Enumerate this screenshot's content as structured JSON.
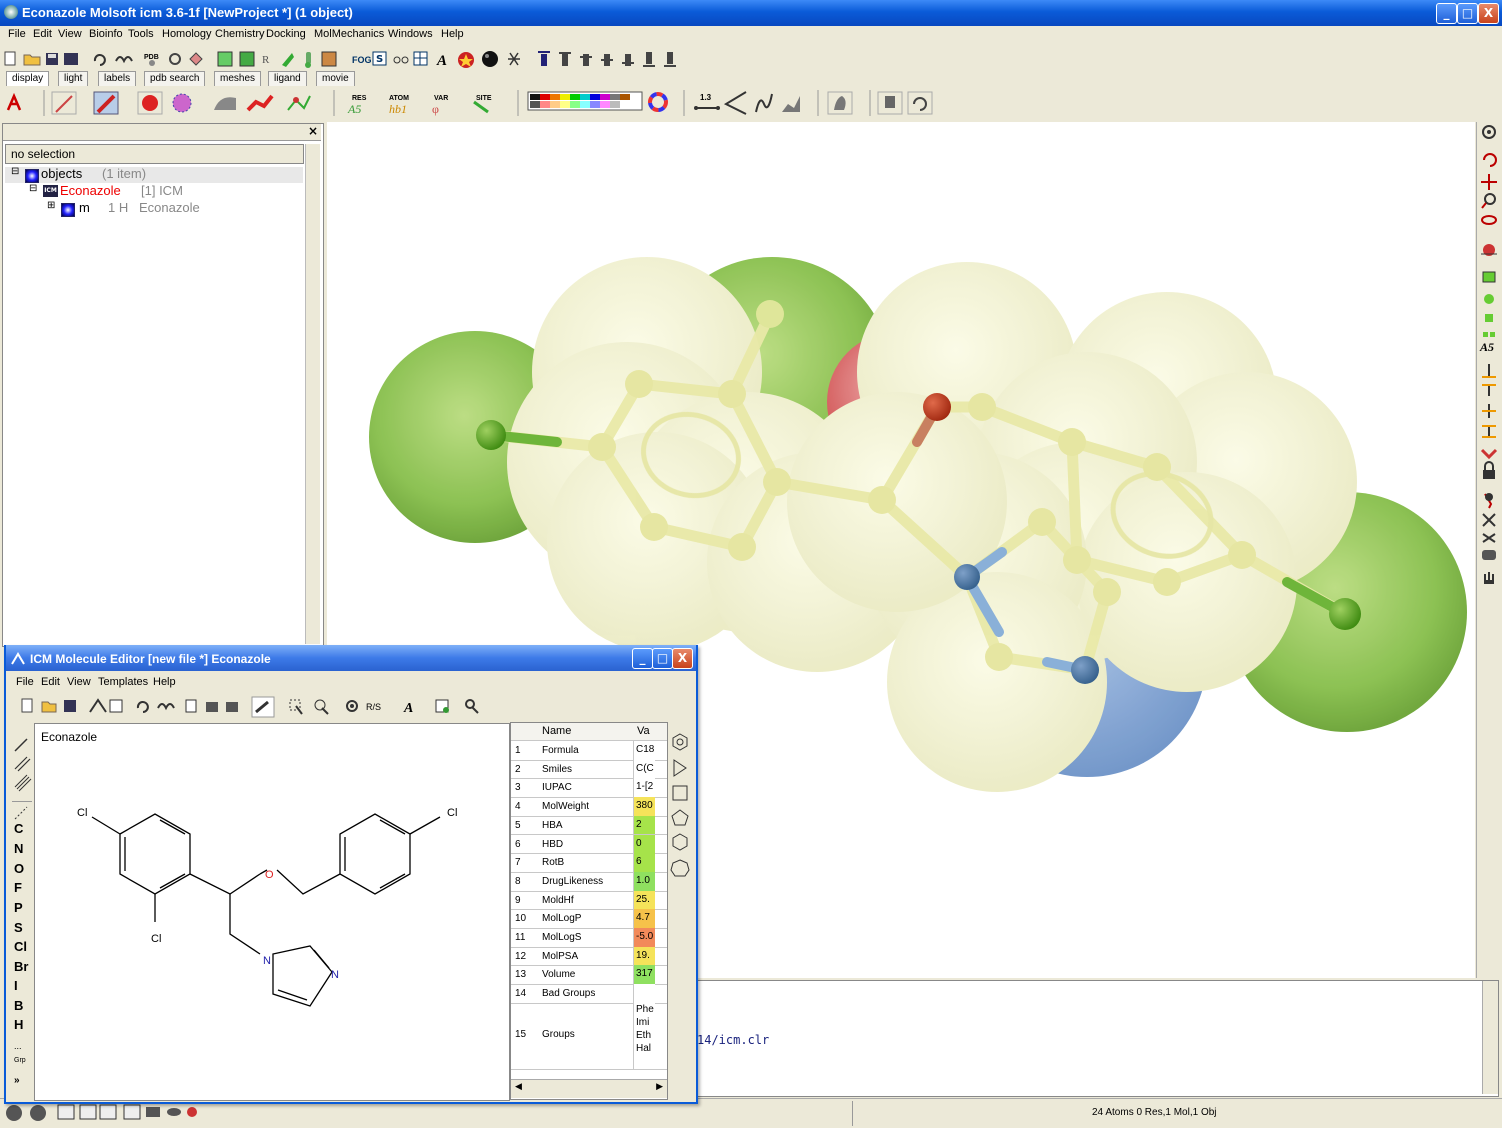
{
  "app": {
    "title": "Econazole Molsoft icm 3.6-1f  [NewProject *] (1 object)",
    "menu": [
      "File",
      "Edit",
      "View",
      "Bioinfo",
      "Tools",
      "Homology",
      "Chemistry",
      "Docking",
      "MolMechanics",
      "Windows",
      "Help"
    ],
    "window_buttons": {
      "minimize": "_",
      "maximize": "□",
      "close": "X"
    }
  },
  "toolbar_tabs": [
    "display",
    "light",
    "labels",
    "pdb search",
    "meshes",
    "ligand",
    "movie"
  ],
  "toolbar_text": {
    "pdb": "PDB",
    "fog": "FOG",
    "res": "RES",
    "res_sub": "A5",
    "atom": "ATOM",
    "atom_sub": "hb1",
    "var": "VAR",
    "site": "SITE",
    "dist": "1.3"
  },
  "workspace": {
    "selection": "no selection",
    "tree": {
      "root_label": "objects",
      "root_count": "(1 item)",
      "object_name": "Econazole",
      "object_info": "[1] ICM",
      "object_badge": "ICM",
      "mol_name": "m",
      "mol_count": "1 H",
      "mol_label": "Econazole"
    },
    "close_glyph": "×"
  },
  "console": {
    "line": "14/icm.clr"
  },
  "status": {
    "text": "24 Atoms 0 Res,1 Mol,1 Obj"
  },
  "editor": {
    "title": "ICM Molecule Editor [new file *] Econazole",
    "menu": [
      "File",
      "Edit",
      "View",
      "Templates",
      "Help"
    ],
    "molecule_name": "Econazole",
    "rs_label": "R/S",
    "atoms": [
      "C",
      "N",
      "O",
      "F",
      "P",
      "S",
      "Cl",
      "Br",
      "I",
      "B",
      "H"
    ],
    "atom_more": "...",
    "grp_label": "Grp",
    "structure_labels": {
      "cl1": "Cl",
      "cl2": "Cl",
      "cl3": "Cl",
      "o": "O",
      "n1": "N",
      "n2": "N"
    },
    "table_headers": {
      "name": "Name",
      "value": "Va"
    },
    "properties": [
      {
        "n": "1",
        "name": "Formula",
        "value": "C18",
        "color": "#ffffff"
      },
      {
        "n": "2",
        "name": "Smiles",
        "value": "C(C",
        "color": "#ffffff"
      },
      {
        "n": "3",
        "name": "IUPAC",
        "value": "1-[2",
        "color": "#ffffff"
      },
      {
        "n": "4",
        "name": "MolWeight",
        "value": "380",
        "color": "#f5e35a"
      },
      {
        "n": "5",
        "name": "HBA",
        "value": "2",
        "color": "#a6e34a"
      },
      {
        "n": "6",
        "name": "HBD",
        "value": "0",
        "color": "#a6e34a"
      },
      {
        "n": "7",
        "name": "RotB",
        "value": "6",
        "color": "#a6e34a"
      },
      {
        "n": "8",
        "name": "DrugLikeness",
        "value": "1.0",
        "color": "#8fe060"
      },
      {
        "n": "9",
        "name": "MoldHf",
        "value": "25.",
        "color": "#f5e35a"
      },
      {
        "n": "10",
        "name": "MolLogP",
        "value": "4.7",
        "color": "#f6c24a"
      },
      {
        "n": "11",
        "name": "MolLogS",
        "value": "-5.0",
        "color": "#f28a5a"
      },
      {
        "n": "12",
        "name": "MolPSA",
        "value": "19.",
        "color": "#f5e35a"
      },
      {
        "n": "13",
        "name": "Volume",
        "value": "317",
        "color": "#8fe060"
      },
      {
        "n": "14",
        "name": "Bad Groups",
        "value": "",
        "color": "#ffffff"
      },
      {
        "n": "15",
        "name": "Groups",
        "value": "Phe\nImi\nEth\nHal",
        "color": "#ffffff"
      }
    ]
  },
  "colors": {
    "title_blue": "#0a5bd8",
    "chlorine": "#7ab83a",
    "carbon_sphere": "#f2f2c6",
    "nitrogen": "#6d93c8",
    "oxygen": "#d45050"
  }
}
